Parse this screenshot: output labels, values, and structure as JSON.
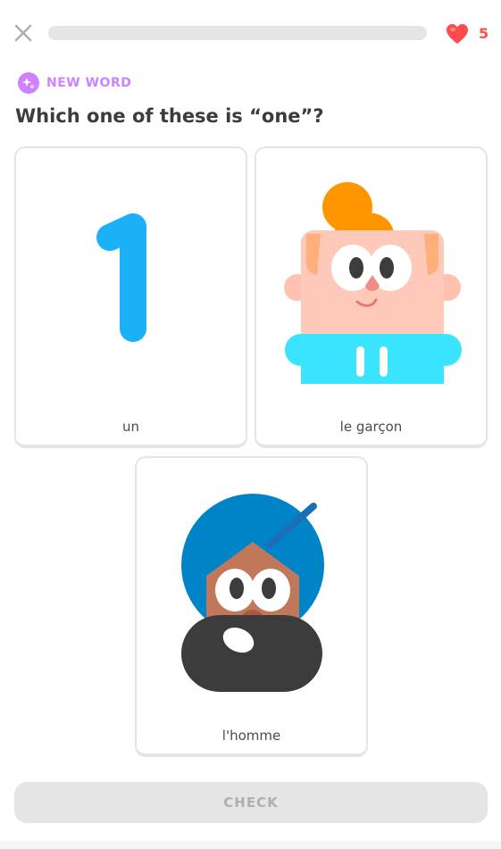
{
  "header": {
    "hearts": "5",
    "progress_percent": 0
  },
  "badge": {
    "label": "NEW WORD"
  },
  "question": "Which one of these is “one”?",
  "choices": [
    {
      "label": "un",
      "icon": "number-one-illustration"
    },
    {
      "label": "le garçon",
      "icon": "boy-illustration"
    },
    {
      "label": "l'homme",
      "icon": "man-turban-illustration"
    }
  ],
  "footer": {
    "check_label": "CHECK"
  },
  "colors": {
    "accent_purple": "#ce82ff",
    "heart_red": "#ff4b4b",
    "number_blue": "#1cb0f6",
    "disabled_gray": "#e5e5e5"
  }
}
